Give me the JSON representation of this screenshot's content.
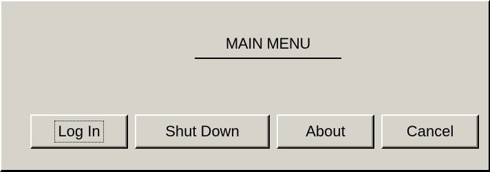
{
  "menu": {
    "title": "MAIN MENU"
  },
  "buttons": [
    {
      "label": "Log In",
      "focused": true
    },
    {
      "label": "Shut Down",
      "focused": false
    },
    {
      "label": "About",
      "focused": false
    },
    {
      "label": "Cancel",
      "focused": false
    }
  ],
  "colors": {
    "window_background": "#d6d3ca",
    "text": "#000000"
  }
}
